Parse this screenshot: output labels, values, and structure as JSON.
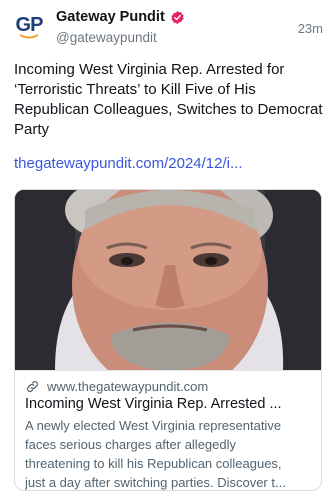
{
  "account": {
    "avatar_text": "GP",
    "display_name": "Gateway Pundit",
    "handle": "@gatewaypundit",
    "timestamp": "23m"
  },
  "post": {
    "text": "Incoming West Virginia Rep. Arrested for ‘Terroristic Threats’ to Kill Five of His Republican Colleagues, Switches to Democrat Party",
    "link_text": "thegatewaypundit.com/2024/12/i..."
  },
  "card": {
    "domain": "www.thegatewaypundit.com",
    "title": "Incoming West Virginia Rep. Arrested ...",
    "description_lines": [
      "A newly elected West Virginia representative",
      "faces serious charges after allegedly",
      "threatening to kill his Republican colleagues,",
      "just a day after switching parties. Discover t..."
    ]
  },
  "colors": {
    "brand_blue": "#1d3f7a",
    "link": "#3b57d9",
    "verified": "#e0245e",
    "secondary_text": "#536471"
  }
}
